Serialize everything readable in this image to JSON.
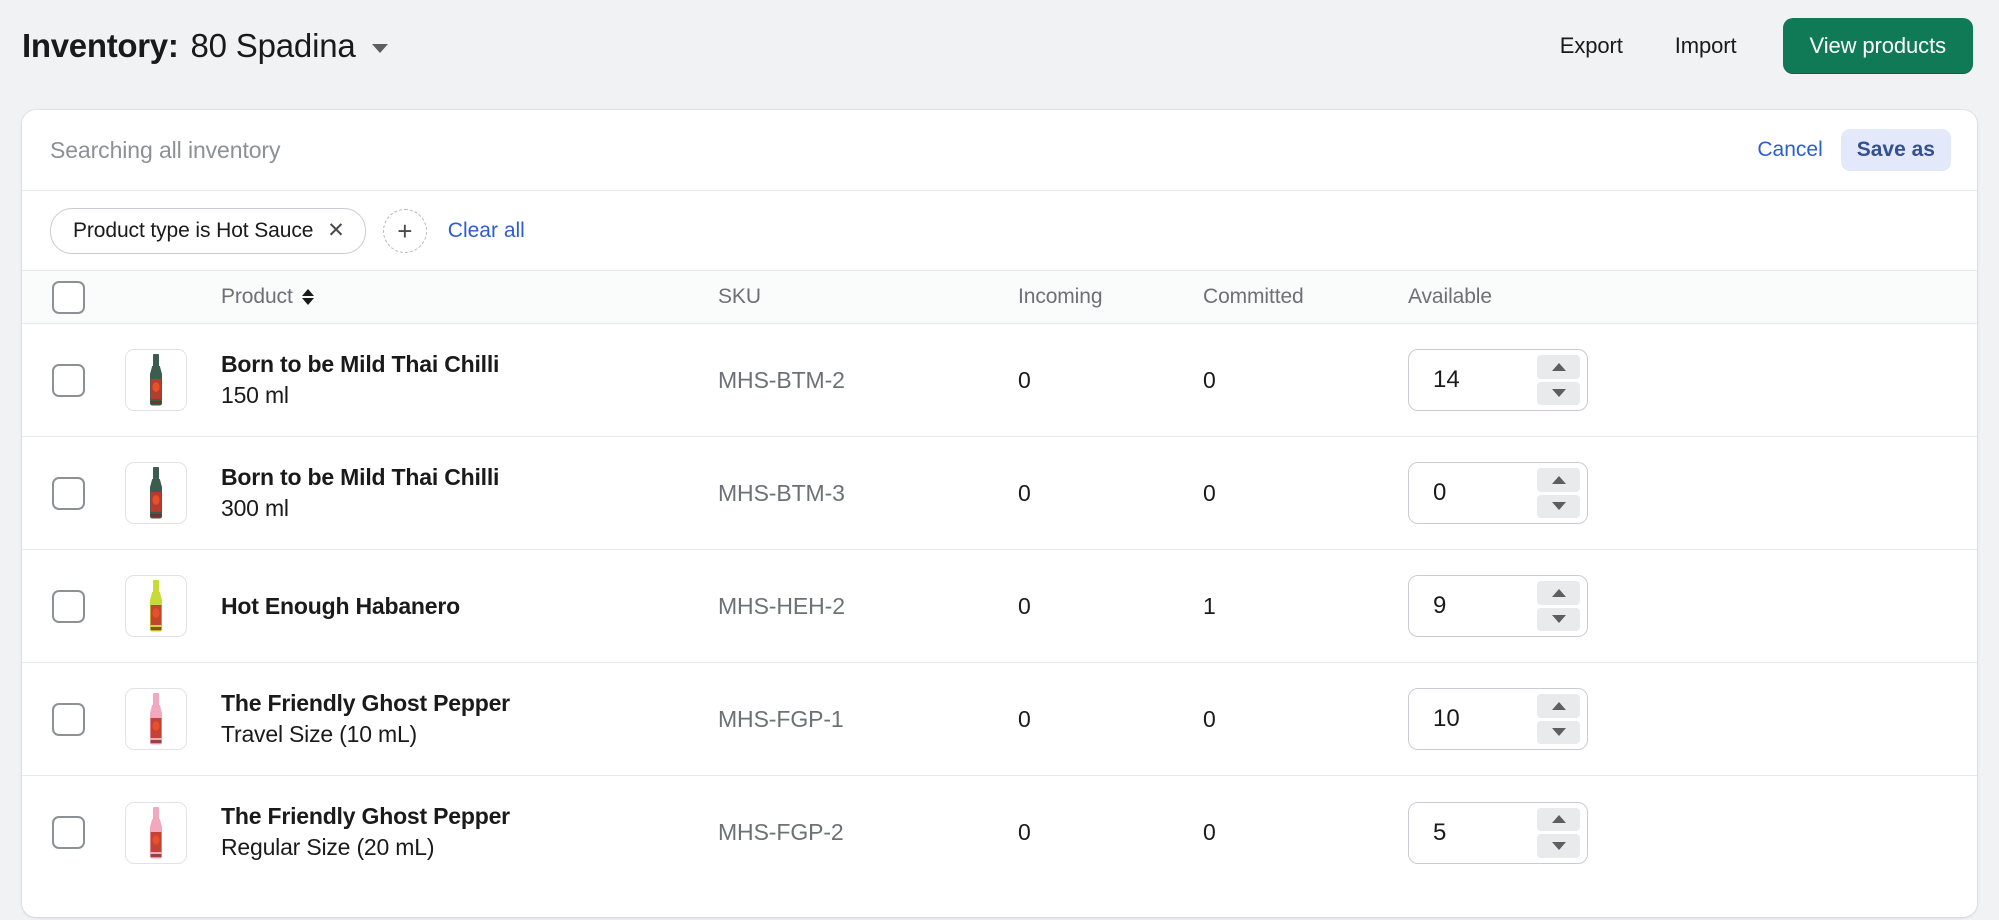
{
  "header": {
    "title_label": "Inventory:",
    "location": "80 Spadina",
    "location_caret_icon": "chevron-down-icon",
    "export_label": "Export",
    "import_label": "Import",
    "view_products_label": "View products",
    "primary_color": "#0f7a55"
  },
  "search": {
    "text": "Searching all inventory",
    "cancel_label": "Cancel",
    "save_as_label": "Save as",
    "link_color": "#2c5ecf",
    "save_as_bg": "#e3e8fa"
  },
  "filters": {
    "chip_label": "Product type is Hot Sauce",
    "chip_remove_icon": "close-icon",
    "add_filter_icon": "plus-icon",
    "add_filter_label": "+",
    "clear_all_label": "Clear all"
  },
  "table": {
    "columns": {
      "select": "",
      "thumbnail": "",
      "product": "Product",
      "sku": "SKU",
      "incoming": "Incoming",
      "committed": "Committed",
      "available": "Available"
    },
    "sort_icon": "sort-arrows-icon",
    "rows": [
      {
        "name": "Born to be Mild Thai Chilli",
        "variant": "150 ml",
        "sku": "MHS-BTM-2",
        "incoming": "0",
        "committed": "0",
        "available": "14",
        "thumb_color": "#3d5c50",
        "thumb_cap_color": "#3d5c50"
      },
      {
        "name": "Born to be Mild Thai Chilli",
        "variant": "300 ml",
        "sku": "MHS-BTM-3",
        "incoming": "0",
        "committed": "0",
        "available": "0",
        "thumb_color": "#3d5c50",
        "thumb_cap_color": "#3d5c50"
      },
      {
        "name": "Hot Enough Habanero",
        "variant": "",
        "sku": "MHS-HEH-2",
        "incoming": "0",
        "committed": "1",
        "available": "9",
        "thumb_color": "#c8d93a",
        "thumb_cap_color": "#c8d93a"
      },
      {
        "name": "The Friendly Ghost Pepper",
        "variant": "Travel Size (10 mL)",
        "sku": "MHS-FGP-1",
        "incoming": "0",
        "committed": "0",
        "available": "10",
        "thumb_color": "#f4a8c0",
        "thumb_cap_color": "#f4a8c0"
      },
      {
        "name": "The Friendly Ghost Pepper",
        "variant": "Regular Size (20 mL)",
        "sku": "MHS-FGP-2",
        "incoming": "0",
        "committed": "0",
        "available": "5",
        "thumb_color": "#f4a8c0",
        "thumb_cap_color": "#f4a8c0"
      }
    ],
    "stepper_up_icon": "caret-up-icon",
    "stepper_down_icon": "caret-down-icon",
    "checkbox_icon": "checkbox-unchecked-icon"
  }
}
